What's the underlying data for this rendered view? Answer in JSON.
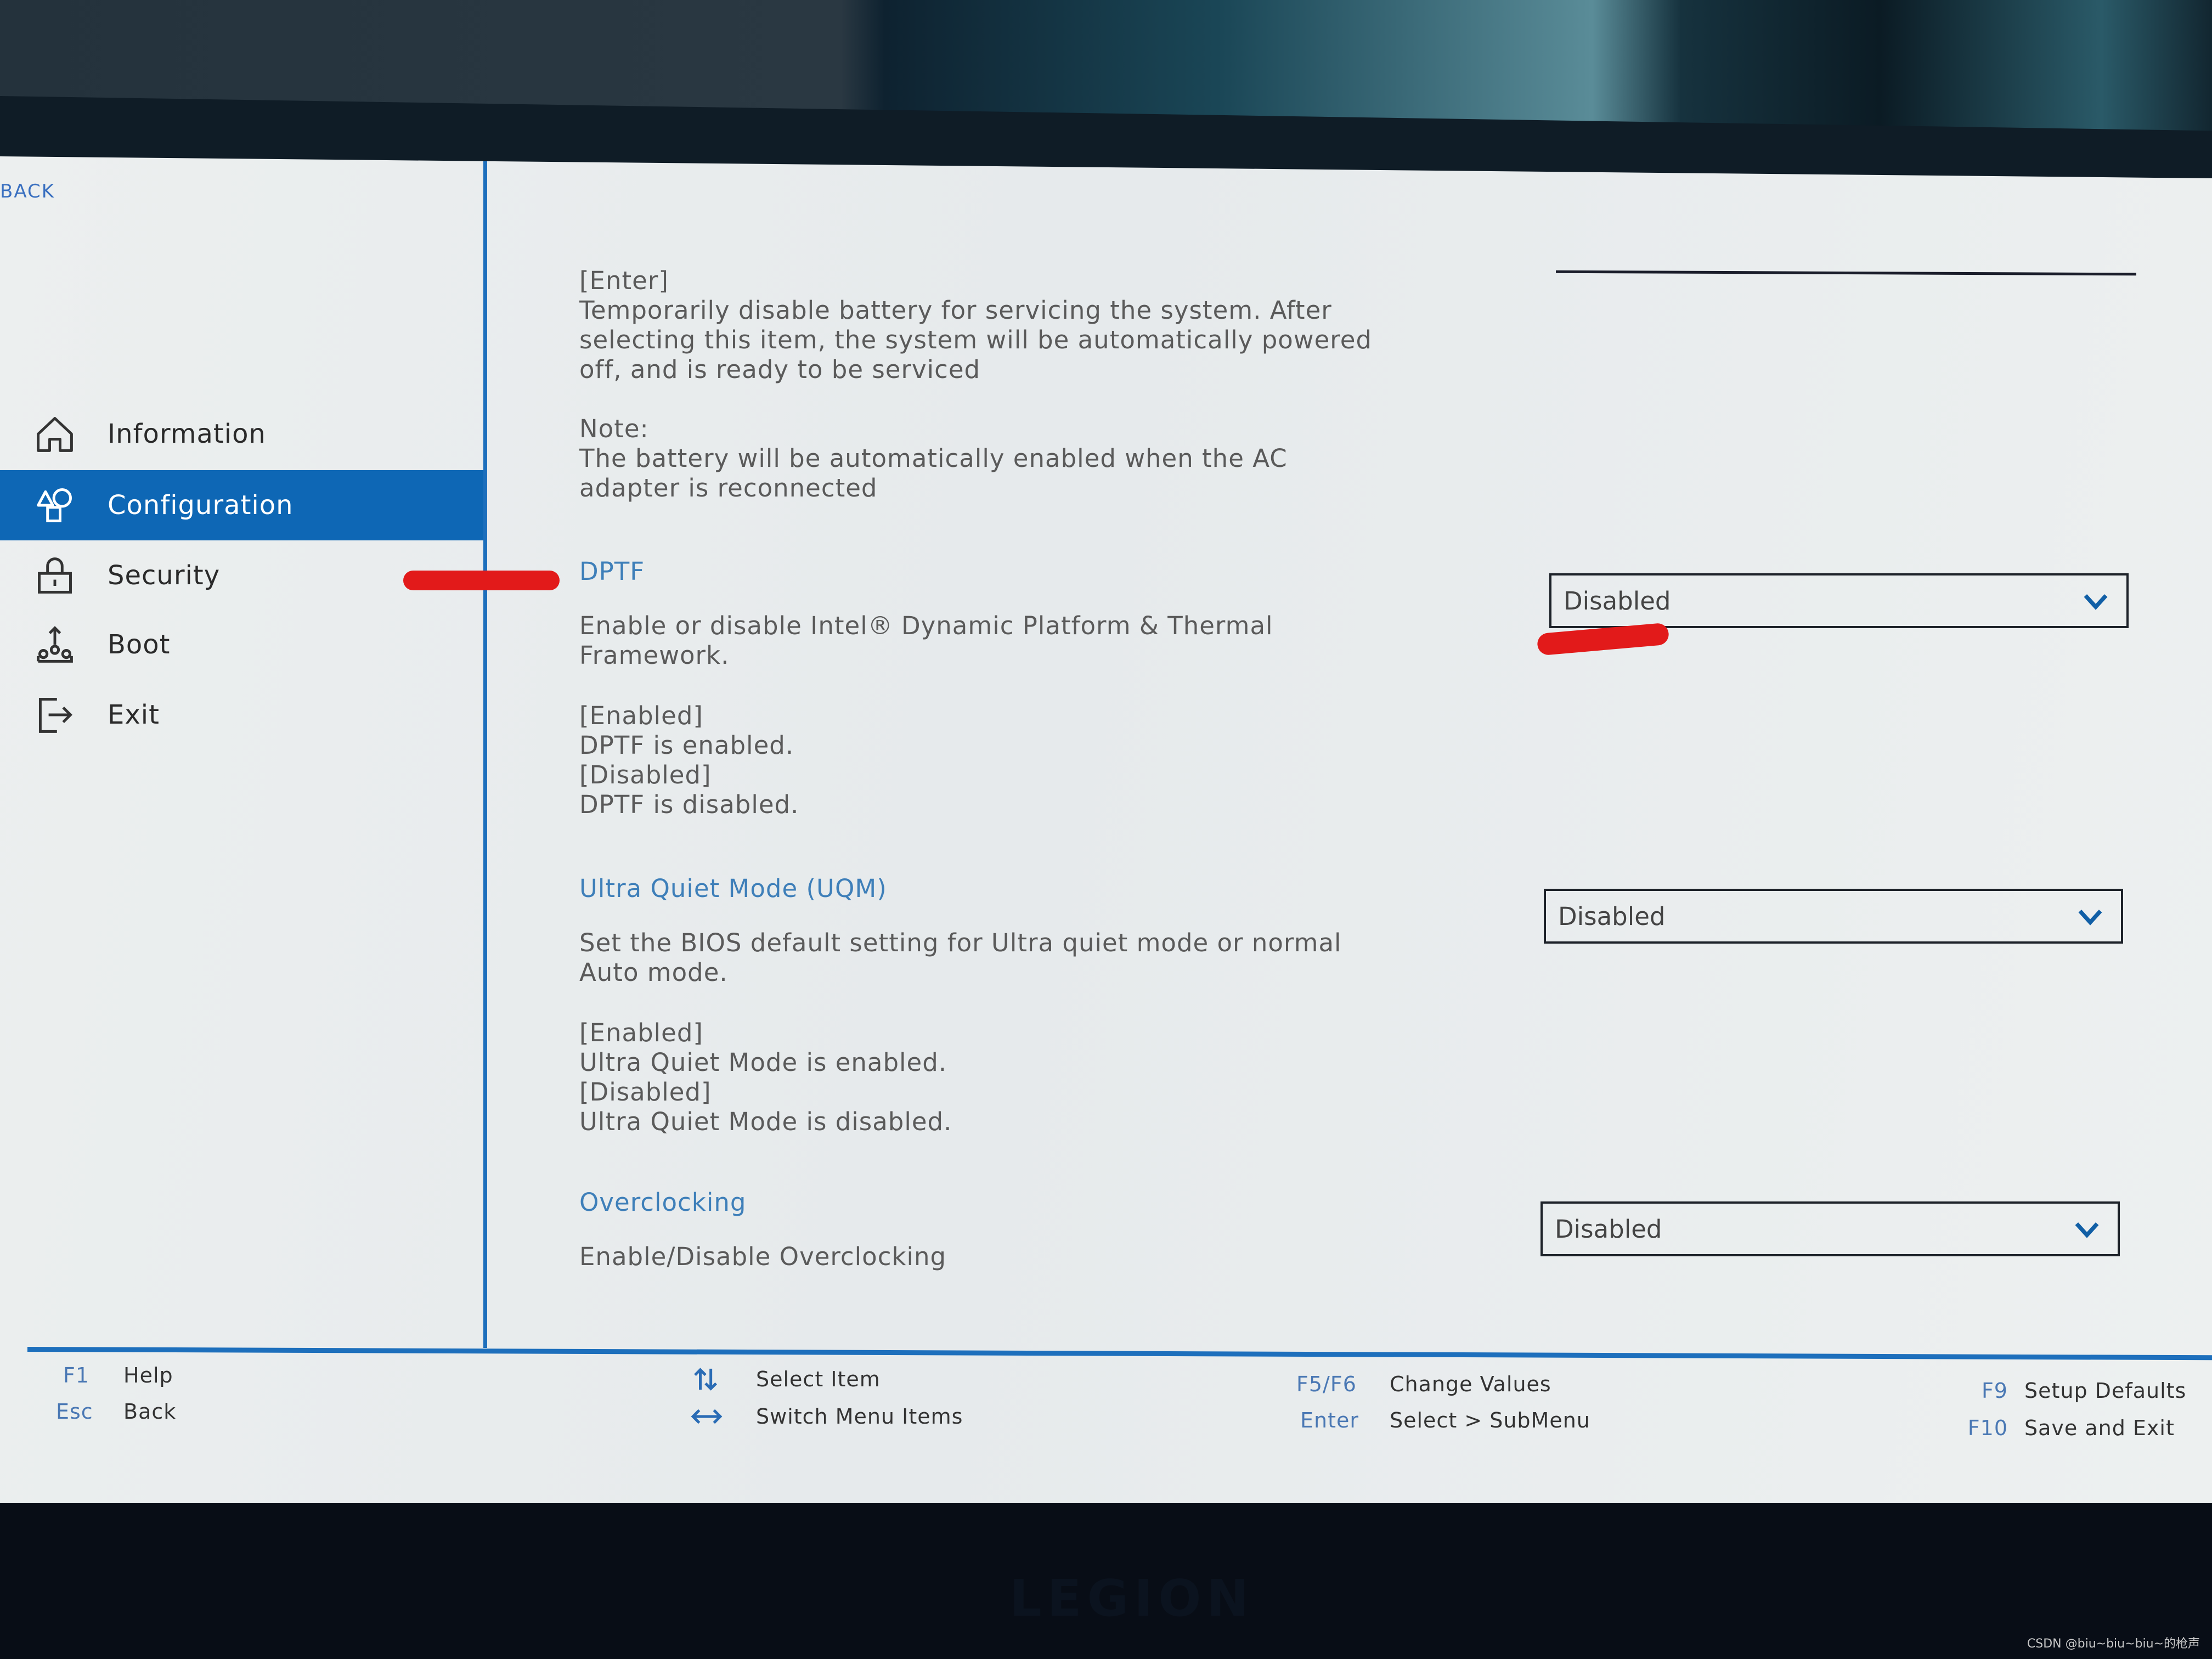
{
  "sidebar": {
    "back_label": "BACK",
    "items": [
      {
        "label": "Information",
        "icon": "home-icon",
        "active": false
      },
      {
        "label": "Configuration",
        "icon": "shapes-icon",
        "active": true
      },
      {
        "label": "Security",
        "icon": "lock-icon",
        "active": false
      },
      {
        "label": "Boot",
        "icon": "boot-icon",
        "active": false
      },
      {
        "label": "Exit",
        "icon": "exit-icon",
        "active": false
      }
    ]
  },
  "main": {
    "previous_item_help": {
      "enter_key": "[Enter]",
      "description": "Temporarily disable battery for servicing the system. After\nselecting this item, the system will be automatically powered\noff, and is ready to be serviced",
      "note_label": "Note:",
      "note_text": "The battery will be automatically enabled when the AC\nadapter is reconnected"
    },
    "settings": [
      {
        "title": "DPTF",
        "description": "Enable or disable Intel® Dynamic Platform & Thermal\nFramework.",
        "options_help": "[Enabled]\nDPTF is enabled.\n[Disabled]\nDPTF is disabled.",
        "value": "Disabled"
      },
      {
        "title": "Ultra Quiet Mode (UQM)",
        "description": "Set the BIOS default setting for Ultra quiet mode or normal\nAuto mode.",
        "options_help": "[Enabled]\nUltra Quiet Mode is enabled.\n[Disabled]\nUltra Quiet Mode is disabled.",
        "value": "Disabled"
      },
      {
        "title": "Overclocking",
        "description": "Enable/Disable Overclocking",
        "options_help": "",
        "value": "Disabled"
      }
    ]
  },
  "footer": {
    "keys": [
      {
        "key": "F1",
        "label": "Help"
      },
      {
        "key": "Esc",
        "label": "Back"
      },
      {
        "key": "up-down-arrows-icon",
        "label": "Select Item"
      },
      {
        "key": "left-right-arrows-icon",
        "label": "Switch Menu Items"
      },
      {
        "key": "F5/F6",
        "label": "Change Values"
      },
      {
        "key": "Enter",
        "label": "Select > SubMenu"
      },
      {
        "key": "F9",
        "label": "Setup Defaults"
      },
      {
        "key": "F10",
        "label": "Save and Exit"
      }
    ]
  },
  "bezel": {
    "brand": "LEGION"
  },
  "watermark": "CSDN @biu~biu~biu~的枪声",
  "colors": {
    "accent": "#0e67b5",
    "title_blue": "#3e7fb9",
    "annotation_red": "#e21a1a"
  }
}
